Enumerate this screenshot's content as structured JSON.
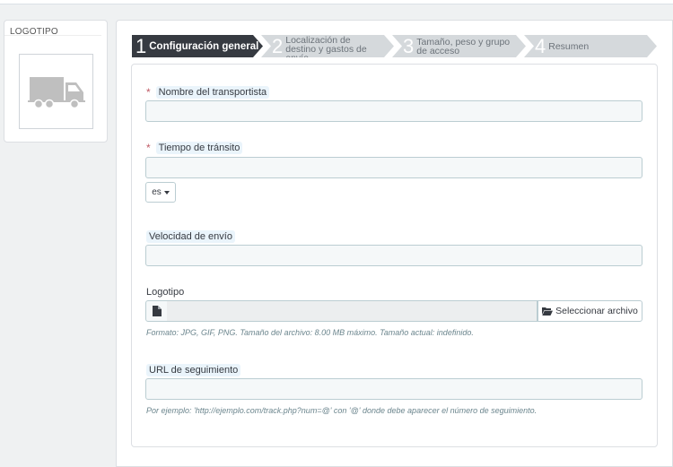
{
  "logo_panel": {
    "title": "LOGOTIPO",
    "image_icon": "truck-icon"
  },
  "steps": [
    {
      "num": "1",
      "label": "Configuración general",
      "active": true
    },
    {
      "num": "2",
      "label": "Localización de destino y gastos de envío",
      "active": false
    },
    {
      "num": "3",
      "label": "Tamaño, peso y grupo de acceso",
      "active": false
    },
    {
      "num": "4",
      "label": "Resumen",
      "active": false
    }
  ],
  "form": {
    "carrier_name": {
      "label": "Nombre del transportista",
      "required": "*",
      "value": ""
    },
    "transit_time": {
      "label": "Tiempo de tránsito",
      "required": "*",
      "value": "",
      "lang": "es"
    },
    "shipping_speed": {
      "label": "Velocidad de envío",
      "value": ""
    },
    "logo": {
      "label": "Logotipo",
      "button_label": "Seleccionar archivo",
      "help": "Formato: JPG, GIF, PNG. Tamaño del archivo: 8.00 MB máximo. Tamaño actual: indefinido."
    },
    "tracking_url": {
      "label": "URL de seguimiento",
      "value": "",
      "help": "Por ejemplo: 'http://ejemplo.com/track.php?num=@' con '@' donde debe aparecer el número de seguimiento."
    }
  },
  "colors": {
    "active_step": "#363a41",
    "inactive_step": "#d5d9dc",
    "required": "#c05c67"
  }
}
